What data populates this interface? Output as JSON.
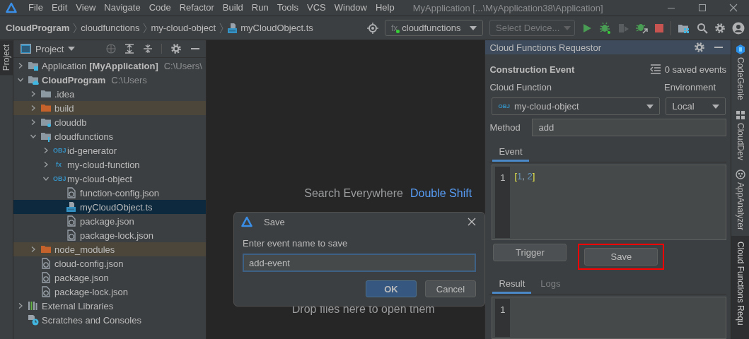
{
  "window": {
    "menu": [
      "File",
      "Edit",
      "View",
      "Navigate",
      "Code",
      "Refactor",
      "Build",
      "Run",
      "Tools",
      "VCS",
      "Window",
      "Help"
    ],
    "title": "MyApplication [...\\MyApplication38\\Application]"
  },
  "toolbar": {
    "breadcrumbs": [
      {
        "label": "CloudProgram",
        "kind": "project"
      },
      {
        "label": "cloudfunctions",
        "kind": "folder"
      },
      {
        "label": "my-cloud-object",
        "kind": "folder"
      },
      {
        "label": "myCloudObject.ts",
        "kind": "ts"
      }
    ],
    "run_config": {
      "badge": "fx",
      "label": "cloudfunctions"
    },
    "device_selector": {
      "label": "Select Device...",
      "disabled": true
    }
  },
  "left_stripe": [
    {
      "label": "Project",
      "selected": true
    }
  ],
  "project": {
    "title": "Project",
    "tree": [
      {
        "label": "Application **[MyApplication]**",
        "path": "C:\\Users\\",
        "kind": "module",
        "bold": false,
        "expanded": false,
        "selected": false,
        "excluded": false
      },
      {
        "label": "CloudProgram",
        "path": "C:\\Users",
        "kind": "cloud-module",
        "bold": true,
        "expanded": true,
        "selected": false,
        "excluded": false,
        "children": [
          {
            "label": ".idea",
            "kind": "folder",
            "expanded": false,
            "selected": false,
            "excluded": false
          },
          {
            "label": "build",
            "kind": "folder",
            "expanded": false,
            "selected": false,
            "excluded": true
          },
          {
            "label": "clouddb",
            "kind": "db-folder",
            "expanded": false,
            "selected": false,
            "excluded": false
          },
          {
            "label": "cloudfunctions",
            "kind": "fn-folder",
            "expanded": true,
            "selected": false,
            "excluded": false,
            "children": [
              {
                "label": "id-generator",
                "badge": "OBJ",
                "kind": "badge",
                "expanded": false,
                "selected": false,
                "excluded": false
              },
              {
                "label": "my-cloud-function",
                "badge": "fx",
                "kind": "badge",
                "expanded": false,
                "selected": false,
                "excluded": false
              },
              {
                "label": "my-cloud-object",
                "badge": "OBJ",
                "kind": "badge",
                "expanded": true,
                "selected": false,
                "excluded": false,
                "children": [
                  {
                    "label": "function-config.json",
                    "kind": "json",
                    "selected": false,
                    "excluded": false
                  },
                  {
                    "label": "myCloudObject.ts",
                    "kind": "ts",
                    "selected": true,
                    "excluded": false
                  },
                  {
                    "label": "package.json",
                    "kind": "json",
                    "selected": false,
                    "excluded": false
                  },
                  {
                    "label": "package-lock.json",
                    "kind": "json",
                    "selected": false,
                    "excluded": false
                  }
                ]
              }
            ]
          },
          {
            "label": "node_modules",
            "kind": "folder",
            "expanded": false,
            "selected": false,
            "excluded": true
          },
          {
            "label": "cloud-config.json",
            "kind": "json",
            "selected": false,
            "excluded": false
          },
          {
            "label": "package.json",
            "kind": "json",
            "selected": false,
            "excluded": false
          },
          {
            "label": "package-lock.json",
            "kind": "json",
            "selected": false,
            "excluded": false
          }
        ]
      },
      {
        "label": "External Libraries",
        "kind": "libraries",
        "bold": false,
        "expanded": false,
        "selected": false,
        "excluded": false
      },
      {
        "label": "Scratches and Consoles",
        "kind": "scratches",
        "bold": false,
        "selected": false,
        "excluded": false
      }
    ]
  },
  "editor": {
    "hint": "Search Everywhere",
    "shortcut": "Double Shift",
    "drop_hint": "Drop files here to open them"
  },
  "dialog": {
    "title": "Save",
    "prompt": "Enter event name to save",
    "value": "add-event",
    "buttons": [
      {
        "label": "OK",
        "default": true
      },
      {
        "label": "Cancel",
        "default": false
      }
    ]
  },
  "requestor": {
    "title": "Cloud Functions Requestor",
    "section": "Construction Event",
    "saved_events": "0 saved events",
    "function_label": "Cloud Function",
    "function_badge": "OBJ",
    "function_value": "my-cloud-object",
    "environment_label": "Environment",
    "environment_value": "Local",
    "method_label": "Method",
    "method_value": "add",
    "event_tabs": [
      {
        "label": "Event",
        "selected": true
      }
    ],
    "event_lines": [
      {
        "number": "1",
        "code": "[1, 2]"
      }
    ],
    "buttons": [
      {
        "label": "Trigger",
        "highlighted": false
      },
      {
        "label": "Save",
        "highlighted": true
      }
    ],
    "result_tabs": [
      {
        "label": "Result",
        "selected": true
      },
      {
        "label": "Logs",
        "selected": false
      }
    ],
    "result_lines": [
      {
        "number": "1"
      }
    ]
  },
  "right_stripe": [
    {
      "label": "CodeGenie",
      "kind": "genie",
      "selected": false
    },
    {
      "label": "CloudDev",
      "kind": "grid",
      "selected": false
    },
    {
      "label": "AppAnalyzer",
      "kind": "analyzer",
      "selected": false
    },
    {
      "label": "Cloud Functions Requ",
      "kind": "none",
      "selected": true
    }
  ]
}
